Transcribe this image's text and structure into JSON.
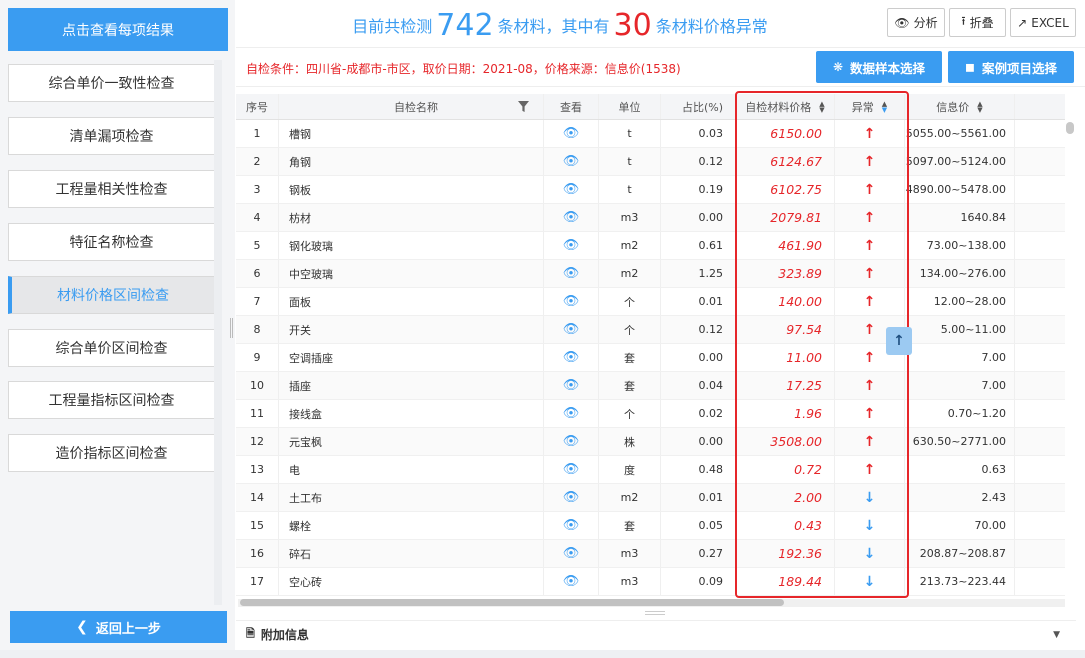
{
  "sidebar": {
    "header": "点击查看每项结果",
    "items": [
      {
        "label": "综合单价一致性检查",
        "active": false
      },
      {
        "label": "清单漏项检查",
        "active": false
      },
      {
        "label": "工程量相关性检查",
        "active": false
      },
      {
        "label": "特征名称检查",
        "active": false
      },
      {
        "label": "材料价格区间检查",
        "active": true
      },
      {
        "label": "综合单价区间检查",
        "active": false
      },
      {
        "label": "工程量指标区间检查",
        "active": false
      },
      {
        "label": "造价指标区间检查",
        "active": false
      }
    ],
    "back_label": "返回上一步"
  },
  "summary": {
    "prefix": "目前共检测",
    "total": "742",
    "middle": "条材料，其中有",
    "abnormal": "30",
    "suffix": "条材料价格异常"
  },
  "toolbar": {
    "analyze": "分析",
    "fold": "折叠",
    "excel": "EXCEL"
  },
  "conditions": {
    "text": "自检条件：四川省-成都市-市区，取价日期：2021-08，价格来源：信息价(1538)",
    "sample_button": "数据样本选择",
    "case_button": "案例项目选择"
  },
  "table": {
    "headers": {
      "idx": "序号",
      "name": "自检名称",
      "view": "查看",
      "unit": "单位",
      "ratio": "占比(%)",
      "price": "自检材料价格",
      "abnormal": "异常",
      "info": "信息价"
    },
    "rows": [
      {
        "idx": "1",
        "name": "槽钢",
        "unit": "t",
        "ratio": "0.03",
        "price": "6150.00",
        "dir": "up",
        "info": "5055.00~5561.00"
      },
      {
        "idx": "2",
        "name": "角钢",
        "unit": "t",
        "ratio": "0.12",
        "price": "6124.67",
        "dir": "up",
        "info": "5097.00~5124.00"
      },
      {
        "idx": "3",
        "name": "钢板",
        "unit": "t",
        "ratio": "0.19",
        "price": "6102.75",
        "dir": "up",
        "info": "4890.00~5478.00"
      },
      {
        "idx": "4",
        "name": "枋材",
        "unit": "m3",
        "ratio": "0.00",
        "price": "2079.81",
        "dir": "up",
        "info": "1640.84"
      },
      {
        "idx": "5",
        "name": "钢化玻璃",
        "unit": "m2",
        "ratio": "0.61",
        "price": "461.90",
        "dir": "up",
        "info": "73.00~138.00"
      },
      {
        "idx": "6",
        "name": "中空玻璃",
        "unit": "m2",
        "ratio": "1.25",
        "price": "323.89",
        "dir": "up",
        "info": "134.00~276.00"
      },
      {
        "idx": "7",
        "name": "面板",
        "unit": "个",
        "ratio": "0.01",
        "price": "140.00",
        "dir": "up",
        "info": "12.00~28.00"
      },
      {
        "idx": "8",
        "name": "开关",
        "unit": "个",
        "ratio": "0.12",
        "price": "97.54",
        "dir": "up",
        "info": "5.00~11.00"
      },
      {
        "idx": "9",
        "name": "空调插座",
        "unit": "套",
        "ratio": "0.00",
        "price": "11.00",
        "dir": "up",
        "info": "7.00"
      },
      {
        "idx": "10",
        "name": "插座",
        "unit": "套",
        "ratio": "0.04",
        "price": "17.25",
        "dir": "up",
        "info": "7.00"
      },
      {
        "idx": "11",
        "name": "接线盒",
        "unit": "个",
        "ratio": "0.02",
        "price": "1.96",
        "dir": "up",
        "info": "0.70~1.20"
      },
      {
        "idx": "12",
        "name": "元宝枫",
        "unit": "株",
        "ratio": "0.00",
        "price": "3508.00",
        "dir": "up",
        "info": "630.50~2771.00"
      },
      {
        "idx": "13",
        "name": "电",
        "unit": "度",
        "ratio": "0.48",
        "price": "0.72",
        "dir": "up",
        "info": "0.63"
      },
      {
        "idx": "14",
        "name": "土工布",
        "unit": "m2",
        "ratio": "0.01",
        "price": "2.00",
        "dir": "down",
        "info": "2.43"
      },
      {
        "idx": "15",
        "name": "螺栓",
        "unit": "套",
        "ratio": "0.05",
        "price": "0.43",
        "dir": "down",
        "info": "70.00"
      },
      {
        "idx": "16",
        "name": "碎石",
        "unit": "m3",
        "ratio": "0.27",
        "price": "192.36",
        "dir": "down",
        "info": "208.87~208.87"
      },
      {
        "idx": "17",
        "name": "空心砖",
        "unit": "m3",
        "ratio": "0.09",
        "price": "189.44",
        "dir": "down",
        "info": "213.73~223.44"
      }
    ]
  },
  "extra": {
    "label": "附加信息"
  },
  "colors": {
    "accent": "#3a9cf1",
    "alert": "#e6262a"
  },
  "icons": {
    "view": "eye-icon",
    "up": "arrow-up-icon",
    "down": "arrow-down-icon"
  }
}
